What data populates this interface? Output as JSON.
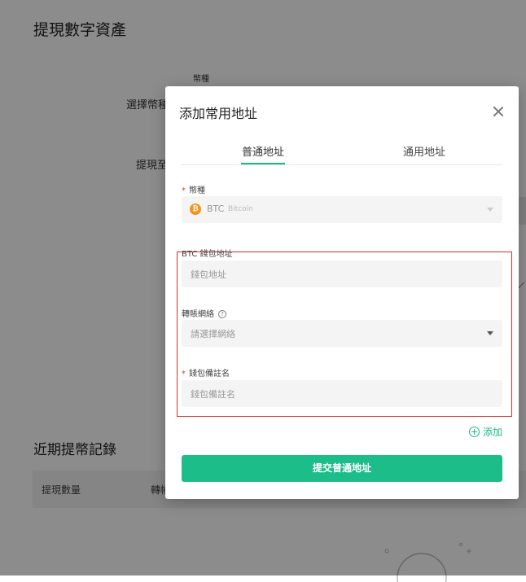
{
  "background": {
    "page_title": "提現數字資產",
    "coin_label_small": "幣種",
    "select_coin_label": "選擇幣種",
    "withdraw_to_label": "提現至",
    "records_title": "近期提幣記錄",
    "table_columns": [
      "提現數量",
      "轉帳"
    ]
  },
  "modal": {
    "title": "添加常用地址",
    "tabs": [
      {
        "label": "普通地址",
        "active": true
      },
      {
        "label": "通用地址",
        "active": false
      }
    ],
    "coin_field": {
      "label": "幣種",
      "coin_code": "BTC",
      "coin_name": "Bitcoin",
      "icon": "bitcoin-icon"
    },
    "address_field": {
      "label": "BTC 錢包地址",
      "placeholder": "錢包地址"
    },
    "network_field": {
      "label": "轉賬網絡",
      "placeholder": "請選擇網絡",
      "help_icon": "question-circle-icon"
    },
    "remark_field": {
      "label": "錢包備註名",
      "placeholder": "錢包備註名"
    },
    "add_link": "添加",
    "submit_label": "提交普通地址"
  },
  "colors": {
    "accent": "#1dbd8a",
    "required_star": "#e53935",
    "highlight_frame": "#d32f2f",
    "bitcoin": "#f7931a"
  }
}
